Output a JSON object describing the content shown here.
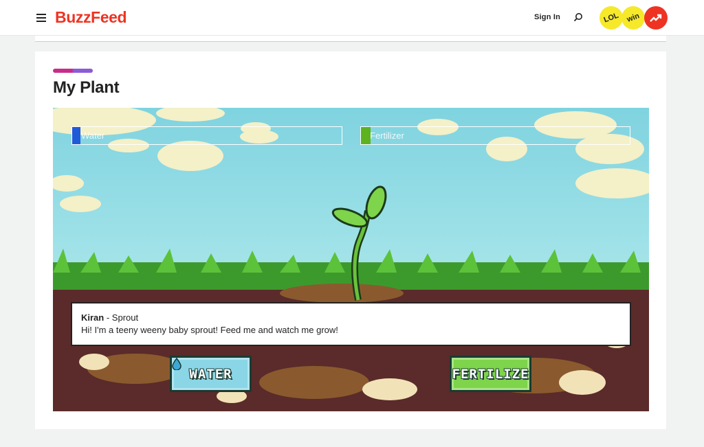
{
  "header": {
    "logo": "BuzzFeed",
    "sign_in": "Sign In",
    "badges": {
      "lol": "LOL",
      "win": "win"
    }
  },
  "page": {
    "title": "My Plant"
  },
  "game": {
    "meters": {
      "water": {
        "label": "Water",
        "level": 0.03,
        "color": "#1f5bd8"
      },
      "fertilizer": {
        "label": "Fertilizer",
        "level": 0.035,
        "color": "#5cb21f"
      }
    },
    "dialog": {
      "speaker": "Kiran",
      "stage": " - Sprout",
      "message": "Hi! I'm a teeny weeny baby sprout! Feed me and watch me grow!"
    },
    "buttons": {
      "water": "WATER",
      "fertilize": "FERTILIZE"
    }
  },
  "colors": {
    "brand": "#ee3322",
    "sky": "#8fdde6",
    "grass": "#3c9a2c",
    "soil": "#5a2b2a"
  }
}
